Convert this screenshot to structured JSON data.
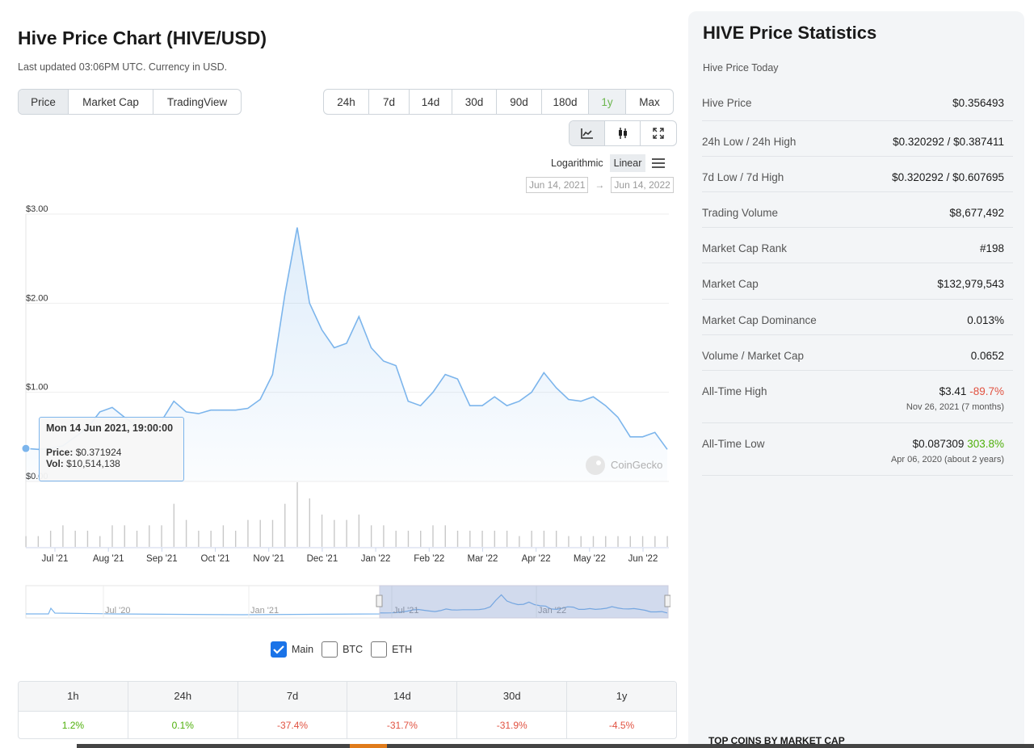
{
  "header": {
    "title": "Hive Price Chart (HIVE/USD)",
    "updated": "Last updated 03:06PM UTC. Currency in USD."
  },
  "tabs": [
    "Price",
    "Market Cap",
    "TradingView"
  ],
  "ranges": [
    "24h",
    "7d",
    "14d",
    "30d",
    "90d",
    "180d",
    "1y",
    "Max"
  ],
  "active_range": "1y",
  "scale": {
    "log_label": "Logarithmic",
    "linear_label": "Linear"
  },
  "date_range": {
    "from": "Jun 14, 2021",
    "to": "Jun 14, 2022",
    "arrow": "→"
  },
  "tooltip": {
    "title": "Mon 14 Jun 2021, 19:00:00",
    "price_label": "Price:",
    "price_value": "$0.371924",
    "vol_label": "Vol:",
    "vol_value": "$10,514,138"
  },
  "watermark": "CoinGecko",
  "chart_data": {
    "type": "line",
    "y_ticks": [
      "$3.00",
      "$2.00",
      "$1.00",
      "$0.00"
    ],
    "ylim": [
      0,
      3
    ],
    "x_ticks": [
      "Jul '21",
      "Aug '21",
      "Sep '21",
      "Oct '21",
      "Nov '21",
      "Dec '21",
      "Jan '22",
      "Feb '22",
      "Mar '22",
      "Apr '22",
      "May '22",
      "Jun '22"
    ],
    "x": [
      0,
      1,
      2,
      3,
      4,
      5,
      6,
      7,
      8,
      9,
      10,
      11,
      12,
      13,
      14,
      15,
      16,
      17,
      18,
      19,
      20,
      21,
      22,
      23,
      24,
      25,
      26,
      27,
      28,
      29,
      30,
      31,
      32,
      33,
      34,
      35,
      36,
      37,
      38,
      39,
      40,
      41,
      42,
      43,
      44,
      45,
      46,
      47,
      48,
      49,
      50,
      51,
      52
    ],
    "series": [
      {
        "values": [
          0.37,
          0.36,
          0.37,
          0.4,
          0.5,
          0.6,
          0.78,
          0.83,
          0.72,
          0.62,
          0.55,
          0.68,
          0.9,
          0.78,
          0.76,
          0.8,
          0.8,
          0.8,
          0.82,
          0.92,
          1.2,
          2.1,
          2.85,
          2.0,
          1.7,
          1.5,
          1.55,
          1.85,
          1.5,
          1.35,
          1.3,
          0.9,
          0.85,
          1.0,
          1.2,
          1.15,
          0.85,
          0.85,
          0.95,
          0.85,
          0.9,
          1.0,
          1.22,
          1.05,
          0.92,
          0.9,
          0.95,
          0.85,
          0.72,
          0.5,
          0.5,
          0.55,
          0.36
        ]
      }
    ],
    "volume": [
      0.02,
      0.02,
      0.03,
      0.04,
      0.03,
      0.03,
      0.02,
      0.04,
      0.04,
      0.03,
      0.04,
      0.04,
      0.08,
      0.05,
      0.03,
      0.03,
      0.04,
      0.03,
      0.05,
      0.05,
      0.05,
      0.08,
      0.12,
      0.09,
      0.06,
      0.05,
      0.05,
      0.06,
      0.04,
      0.04,
      0.03,
      0.03,
      0.03,
      0.04,
      0.04,
      0.03,
      0.03,
      0.03,
      0.03,
      0.03,
      0.02,
      0.03,
      0.03,
      0.03,
      0.02,
      0.02,
      0.02,
      0.02,
      0.02,
      0.02,
      0.02,
      0.02,
      0.02
    ],
    "navigator_labels": [
      "Jul '20",
      "Jan '21",
      "Jul '21",
      "Jan '22"
    ]
  },
  "compare": [
    {
      "label": "Main",
      "checked": true
    },
    {
      "label": "BTC",
      "checked": false
    },
    {
      "label": "ETH",
      "checked": false
    }
  ],
  "performance": {
    "headers": [
      "1h",
      "24h",
      "7d",
      "14d",
      "30d",
      "1y"
    ],
    "values": [
      "1.2%",
      "0.1%",
      "-37.4%",
      "-31.7%",
      "-31.9%",
      "-4.5%"
    ],
    "positive": [
      true,
      true,
      false,
      false,
      false,
      false
    ]
  },
  "stats": {
    "title": "HIVE Price Statistics",
    "subtitle": "Hive Price Today",
    "rows": [
      {
        "key": "Hive Price",
        "value": "$0.356493"
      },
      {
        "key": "24h Low / 24h High",
        "value": "$0.320292 / $0.387411"
      },
      {
        "key": "7d Low / 7d High",
        "value": "$0.320292 / $0.607695"
      },
      {
        "key": "Trading Volume",
        "value": "$8,677,492"
      },
      {
        "key": "Market Cap Rank",
        "value": "#198"
      },
      {
        "key": "Market Cap",
        "value": "$132,979,543"
      },
      {
        "key": "Market Cap Dominance",
        "value": "0.013%"
      },
      {
        "key": "Volume / Market Cap",
        "value": "0.0652"
      }
    ],
    "ath": {
      "key": "All-Time High",
      "value": "$3.41",
      "pct": "-89.7%",
      "date": "Nov 26, 2021 (7 months)"
    },
    "atl": {
      "key": "All-Time Low",
      "value": "$0.087309",
      "pct": "303.8%",
      "date": "Apr 06, 2020 (about 2 years)"
    },
    "top_coins": "TOP COINS BY MARKET CAP"
  }
}
